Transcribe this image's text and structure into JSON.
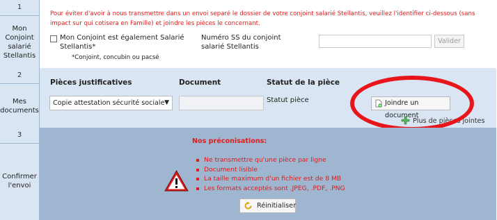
{
  "sections": [
    {
      "number": "1",
      "label": "Mon Conjoint salarié Stellantis"
    },
    {
      "number": "2",
      "label": "Mes documents"
    },
    {
      "number": "3",
      "label": "Confirmer l'envoi"
    }
  ],
  "section1": {
    "notice": "Pour éviter d'avoir à nous transmettre dans un envoi separé le dossier de votre conjoint salarié Stellantis, veuillez l'identifier ci-dessous (sans impact sur qui cotisera en Famille) et joindre les pièces le concernant.",
    "checkbox_label": "Mon Conjoint est également Salarié Stellantis*",
    "checkbox_note": "*Conjoint, concubin ou pacsé",
    "ss_label": "Numéro SS du conjoint salarié Stellantis",
    "ss_value": "",
    "validate_button": "Valider"
  },
  "section2": {
    "col_pieces": "Pièces justificatives",
    "col_document": "Document",
    "col_statut": "Statut de la pièce",
    "select_value": "Copie attestation sécurité sociale",
    "document_value": "",
    "statut_value": "Statut pièce",
    "join_button": "Joindre un document",
    "more_pieces_link": "Plus de pièces jointes"
  },
  "section3": {
    "title": "Nos préconisations:",
    "recommendations": [
      "Ne transmettre qu'une pièce par ligne",
      "Document lisible",
      "La taille maximum d'un fichier est de 8 MB",
      "Les formats acceptés sont .JPEG, .PDF, .PNG"
    ],
    "reset_button": "Réinitialiser"
  },
  "icons": {
    "attach": "attach-document-icon",
    "plus": "add-green-icon",
    "warning": "warning-triangle-icon",
    "reset": "reset-arrow-icon"
  },
  "colors": {
    "warning_text": "#e01b1b",
    "row_blue_light": "#d9e5f3",
    "row_blue_dark": "#9fb6d1",
    "annotation_ring": "#e8151b"
  }
}
